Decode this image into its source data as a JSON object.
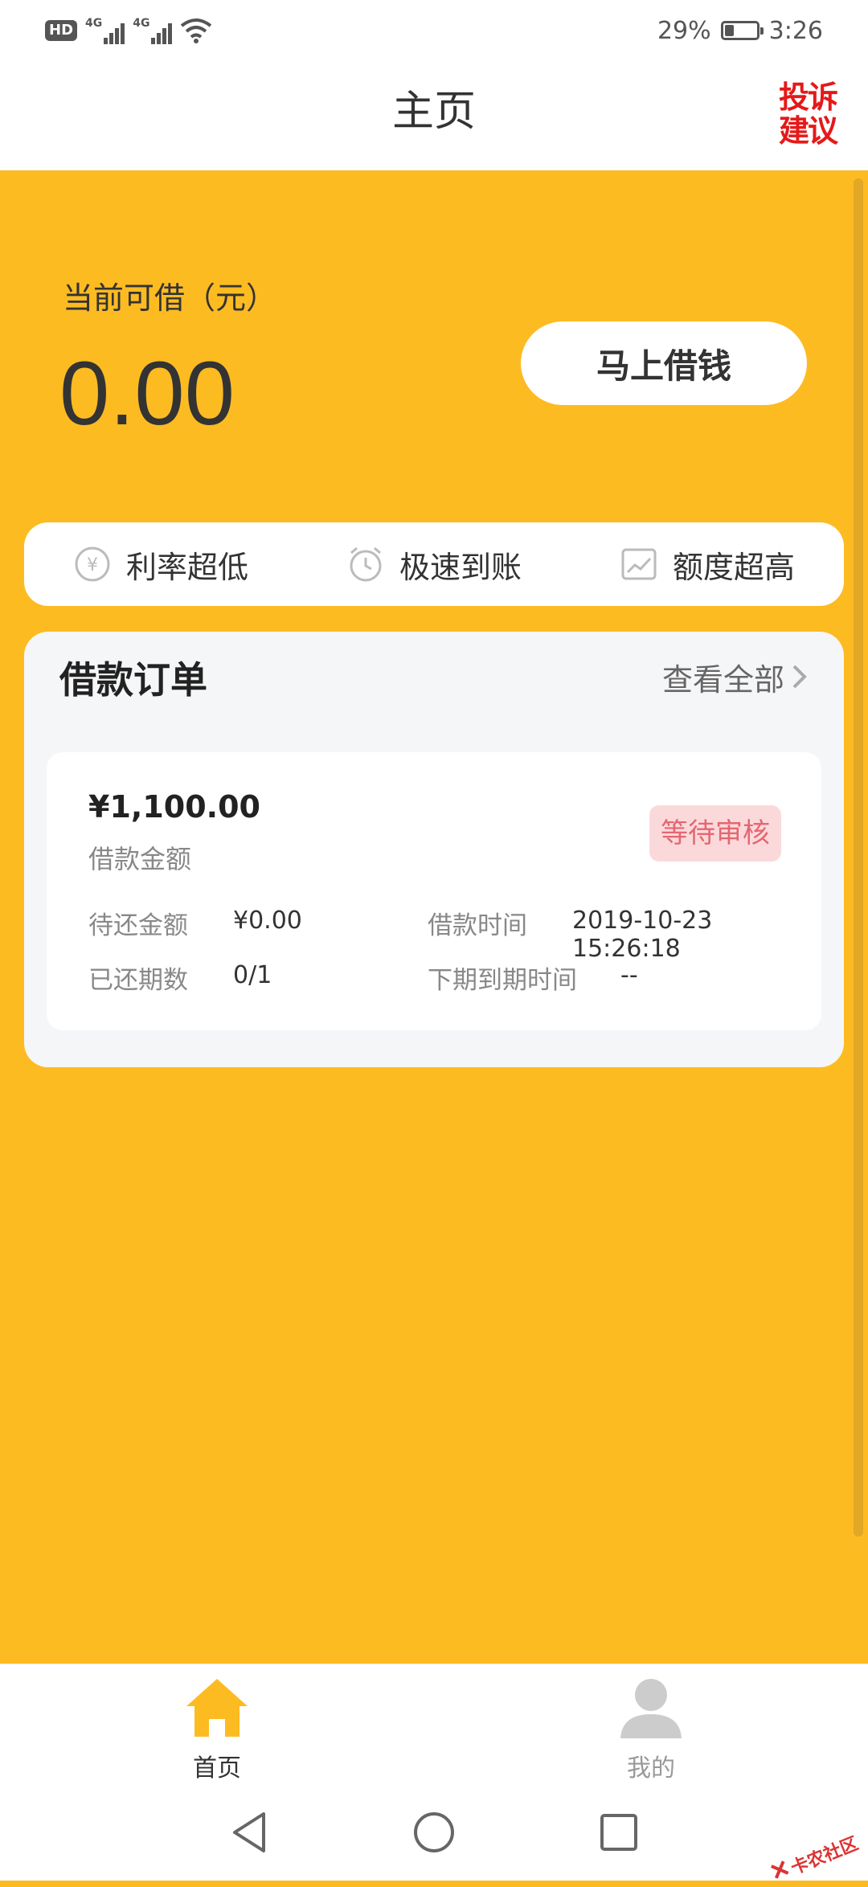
{
  "status_bar": {
    "hd": "HD",
    "network_1": "4G",
    "network_2": "4G",
    "battery": "29%",
    "time": "3:26"
  },
  "header": {
    "title": "主页",
    "complaint_line1": "投诉",
    "complaint_line2": "建议"
  },
  "balance": {
    "label": "当前可借（元）",
    "amount": "0.00",
    "borrow_button": "马上借钱"
  },
  "features": [
    {
      "label": "利率超低",
      "icon": "yen-icon"
    },
    {
      "label": "极速到账",
      "icon": "clock-icon"
    },
    {
      "label": "额度超高",
      "icon": "chart-icon"
    }
  ],
  "orders": {
    "title": "借款订单",
    "view_all": "查看全部",
    "item": {
      "amount": "¥1,100.00",
      "amount_label": "借款金额",
      "status": "等待审核",
      "pending_label": "待还金额",
      "pending_value": "¥0.00",
      "time_label": "借款时间",
      "time_value": "2019-10-23 15:26:18",
      "periods_label": "已还期数",
      "periods_value": "0/1",
      "next_due_label": "下期到期时间",
      "next_due_value": "--"
    }
  },
  "bottom_nav": {
    "home": "首页",
    "mine": "我的"
  },
  "watermark": "卡农社区",
  "colors": {
    "primary": "#FDBB22",
    "badge_bg": "#FBD9DB",
    "badge_text": "#E56671",
    "complaint": "#E51919"
  }
}
